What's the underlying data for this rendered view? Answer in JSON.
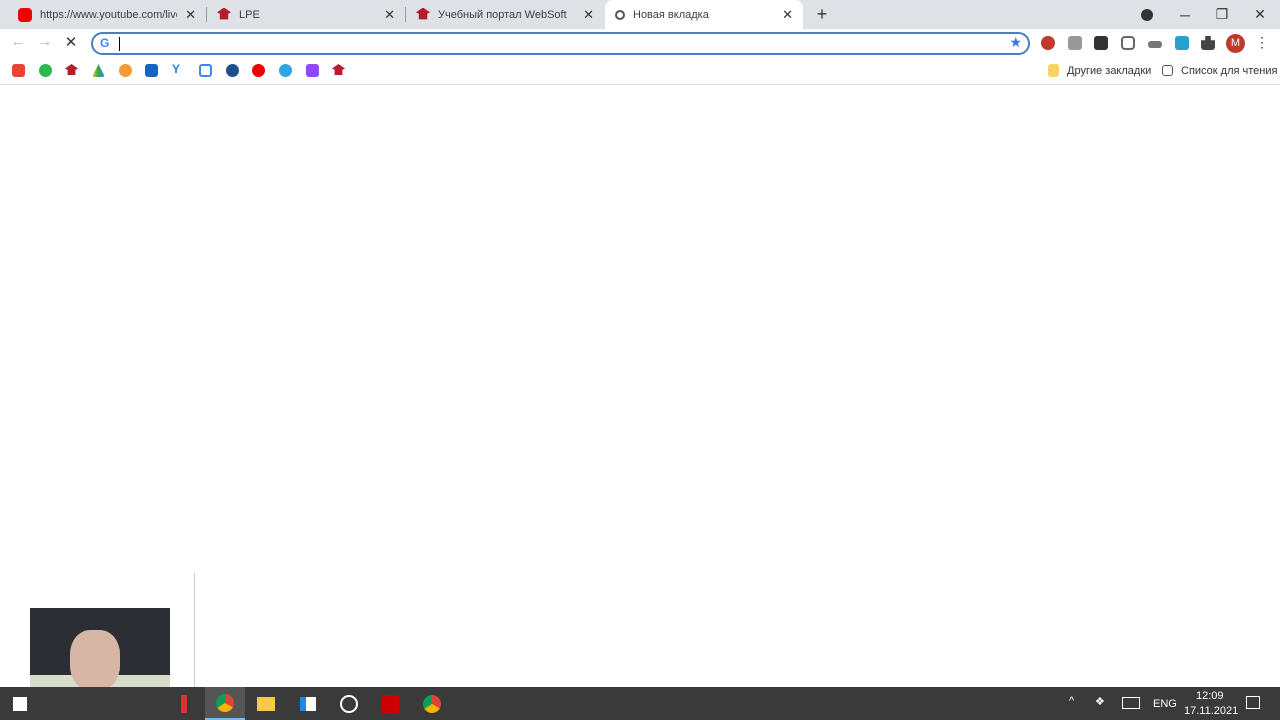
{
  "tabs": [
    {
      "title": "https://www.youtube.com/live_chat",
      "icon": "youtube-icon"
    },
    {
      "title": "LPE",
      "icon": "graduation-cap-icon"
    },
    {
      "title": "Учебный портал WebSoft",
      "icon": "graduation-cap-icon"
    },
    {
      "title": "Новая вкладка",
      "icon": "chrome-newtab-icon",
      "active": true
    }
  ],
  "window": {
    "new_tab": "+",
    "minimize": "─",
    "restore": "❐",
    "close": "✕"
  },
  "omnibox": {
    "value": "",
    "search_engine": "G"
  },
  "profile": {
    "initial": "M",
    "color": "#c0392b"
  },
  "bookmarks": {
    "icons": [
      "gmail",
      "green-3",
      "cap",
      "google-drive",
      "orange",
      "mail",
      "yandex",
      "calendar",
      "blue-app",
      "youtube-music",
      "telegram",
      "twitch",
      "cap"
    ],
    "other_bookmarks": "Другие закладки",
    "reading_list": "Список для чтения"
  },
  "taskbar": {
    "language": "ENG",
    "time": "12:09",
    "date": "17.11.2021"
  }
}
